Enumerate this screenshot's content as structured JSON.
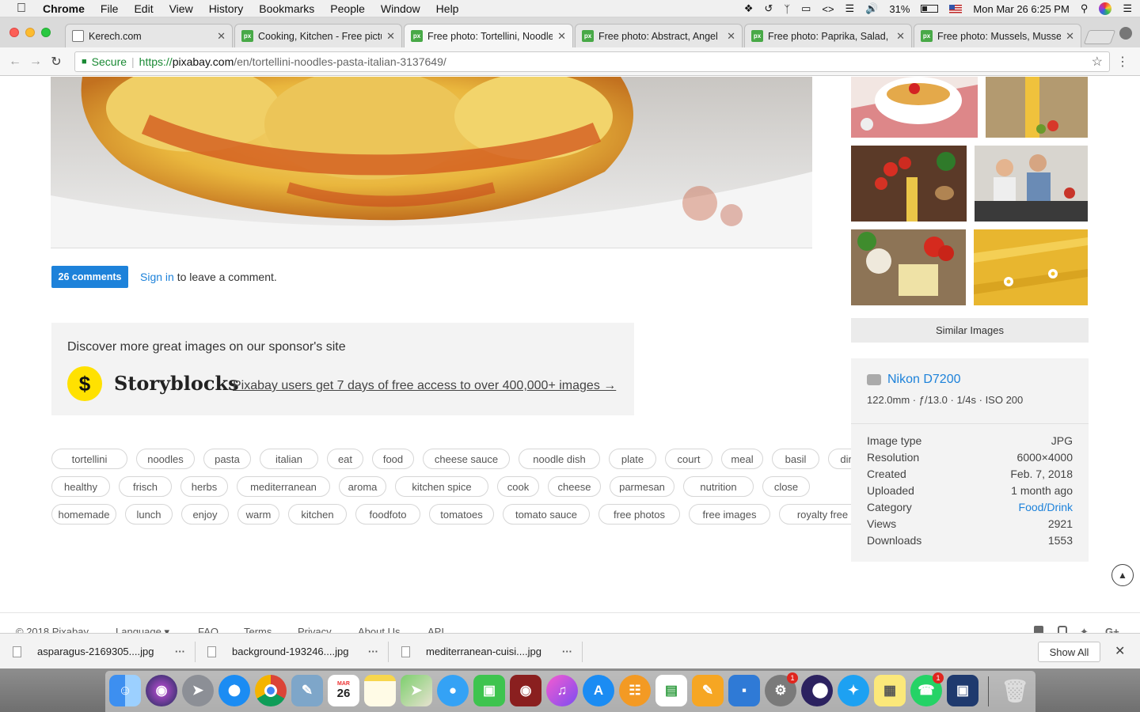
{
  "menubar": {
    "app": "Chrome",
    "items": [
      "File",
      "Edit",
      "View",
      "History",
      "Bookmarks",
      "People",
      "Window",
      "Help"
    ],
    "battery": "31%",
    "clock": "Mon Mar 26  6:25 PM"
  },
  "tabs": [
    {
      "title": "Kerech.com",
      "favicon": "page"
    },
    {
      "title": "Cooking, Kitchen - Free pictu",
      "favicon": "px"
    },
    {
      "title": "Free photo: Tortellini, Noodle",
      "favicon": "px"
    },
    {
      "title": "Free photo: Abstract, Angel",
      "favicon": "px"
    },
    {
      "title": "Free photo: Paprika, Salad, C",
      "favicon": "px"
    },
    {
      "title": "Free photo: Mussels, Mussels",
      "favicon": "px"
    }
  ],
  "omnibox": {
    "secure_label": "Secure",
    "protocol": "https://",
    "host": "pixabay.com",
    "path": "/en/tortellini-noodles-pasta-italian-3137649/"
  },
  "comments": {
    "button": "26 comments",
    "signin_link": "Sign in",
    "signin_suffix": " to leave a comment."
  },
  "sponsor": {
    "heading": "Discover more great images on our sponsor's site",
    "logo_glyph": "$",
    "brand": "Storyblocks",
    "offer": "Pixabay users get 7 days of free access to over 400,000+ images →"
  },
  "tags": [
    [
      "tortellini",
      "noodles",
      "pasta",
      "italian",
      "eat",
      "food",
      "cheese sauce",
      "noodle dish",
      "plate",
      "court",
      "meal",
      "basil",
      "dinner"
    ],
    [
      "healthy",
      "frisch",
      "herbs",
      "mediterranean",
      "aroma",
      "kitchen spice",
      "cook",
      "cheese",
      "parmesan",
      "nutrition",
      "close"
    ],
    [
      "homemade",
      "lunch",
      "enjoy",
      "warm",
      "kitchen",
      "foodfoto",
      "tomatoes",
      "tomato sauce",
      "free photos",
      "free images",
      "royalty free"
    ]
  ],
  "sidebar": {
    "similar_button": "Similar Images",
    "camera": "Nikon D7200",
    "camera_settings": "122.0mm · ƒ/13.0 · 1/4s · ISO 200",
    "meta": [
      {
        "k": "Image type",
        "v": "JPG"
      },
      {
        "k": "Resolution",
        "v": "6000×4000"
      },
      {
        "k": "Created",
        "v": "Feb. 7, 2018"
      },
      {
        "k": "Uploaded",
        "v": "1 month ago"
      },
      {
        "k": "Category",
        "v": "Food/Drink"
      },
      {
        "k": "Views",
        "v": "2921"
      },
      {
        "k": "Downloads",
        "v": "1553"
      }
    ]
  },
  "footer": {
    "items": [
      "© 2018 Pixabay",
      "Language ▾",
      "FAQ",
      "Terms",
      "Privacy",
      "About Us",
      "API"
    ]
  },
  "downloads": {
    "files": [
      "asparagus-2169305....jpg",
      "background-193246....jpg",
      "mediterranean-cuisi....jpg"
    ],
    "show_all": "Show All"
  },
  "dock": {
    "calendar_month": "MAR",
    "calendar_day": "26",
    "badges": [
      "1",
      "1"
    ]
  }
}
